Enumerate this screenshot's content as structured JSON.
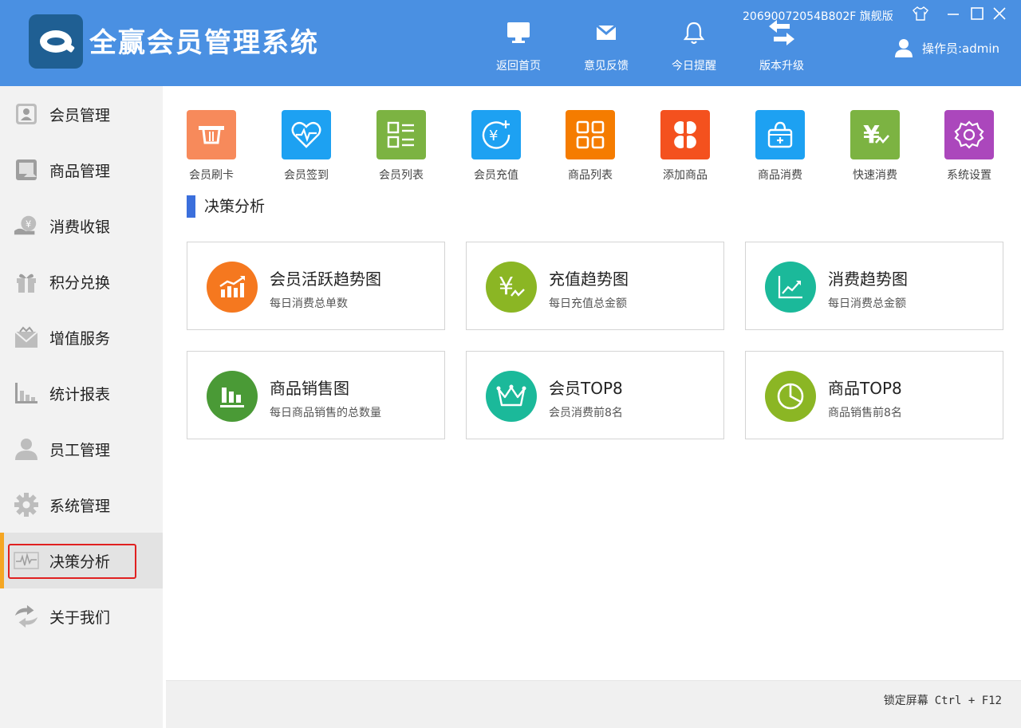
{
  "app": {
    "title": "全赢会员管理系统"
  },
  "header": {
    "nav": [
      {
        "label": "返回首页",
        "icon": "monitor-icon"
      },
      {
        "label": "意见反馈",
        "icon": "mail-icon"
      },
      {
        "label": "今日提醒",
        "icon": "bell-icon"
      },
      {
        "label": "版本升级",
        "icon": "swap-arrows-icon"
      }
    ],
    "serial": "20690072054B802F 旗舰版",
    "operator": "操作员:admin"
  },
  "sidebar": {
    "items": [
      {
        "label": "会员管理",
        "icon": "member-card-icon"
      },
      {
        "label": "商品管理",
        "icon": "product-icon"
      },
      {
        "label": "消费收银",
        "icon": "cashier-icon"
      },
      {
        "label": "积分兑换",
        "icon": "gift-icon"
      },
      {
        "label": "增值服务",
        "icon": "envelope-icon"
      },
      {
        "label": "统计报表",
        "icon": "bar-chart-icon"
      },
      {
        "label": "员工管理",
        "icon": "user-icon"
      },
      {
        "label": "系统管理",
        "icon": "gear-icon"
      },
      {
        "label": "决策分析",
        "icon": "pulse-icon",
        "active": true
      },
      {
        "label": "关于我们",
        "icon": "refresh-arrows-icon"
      }
    ]
  },
  "quick": [
    {
      "label": "会员刷卡",
      "icon": "card-swipe-icon",
      "color": "#f78a5b"
    },
    {
      "label": "会员签到",
      "icon": "heart-pulse-icon",
      "color": "#1da1f2"
    },
    {
      "label": "会员列表",
      "icon": "list-icon",
      "color": "#7cb342"
    },
    {
      "label": "会员充值",
      "icon": "yen-add-icon",
      "color": "#1da1f2"
    },
    {
      "label": "商品列表",
      "icon": "grid-icon",
      "color": "#f57c00"
    },
    {
      "label": "添加商品",
      "icon": "clover-icon",
      "color": "#f4511e"
    },
    {
      "label": "商品消费",
      "icon": "basket-icon",
      "color": "#1da1f2"
    },
    {
      "label": "快速消费",
      "icon": "yen-trend-icon",
      "color": "#7cb342"
    },
    {
      "label": "系统设置",
      "icon": "settings-icon",
      "color": "#ab47bc"
    }
  ],
  "section": {
    "title": "决策分析"
  },
  "cards": [
    {
      "title": "会员活跃趋势图",
      "subtitle": "每日消费总单数",
      "icon": "trend-chart-icon",
      "color": "#f5781f"
    },
    {
      "title": "充值趋势图",
      "subtitle": "每日充值总金额",
      "icon": "yen-wave-icon",
      "color": "#8bb624"
    },
    {
      "title": "消费趋势图",
      "subtitle": "每日消费总金额",
      "icon": "line-chart-icon",
      "color": "#1bb99a"
    },
    {
      "title": "商品销售图",
      "subtitle": "每日商品销售的总数量",
      "icon": "bars-icon",
      "color": "#4a9a36"
    },
    {
      "title": "会员TOP8",
      "subtitle": "会员消费前8名",
      "icon": "crown-icon",
      "color": "#1bb99a"
    },
    {
      "title": "商品TOP8",
      "subtitle": "商品销售前8名",
      "icon": "pie-icon",
      "color": "#8bb624"
    }
  ],
  "footer": {
    "lock_label": "锁定屏幕",
    "lock_keys": "Ctrl + F12"
  }
}
